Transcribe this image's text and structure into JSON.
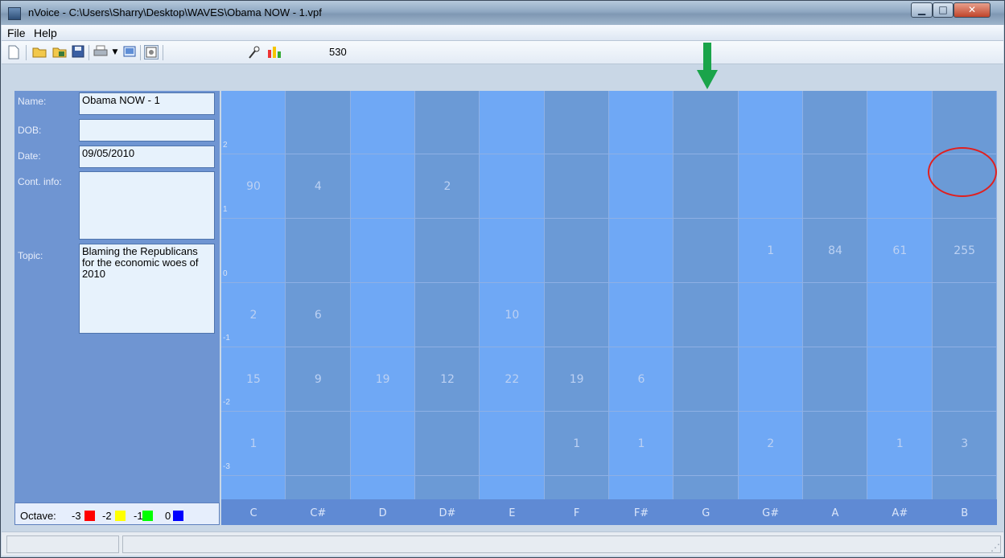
{
  "window": {
    "title": "nVoice - C:\\Users\\Sharry\\Desktop\\WAVES\\Obama NOW - 1.vpf",
    "min_glyph": "▁",
    "max_glyph": "□",
    "close_glyph": "✕"
  },
  "menu": {
    "file": "File",
    "help": "Help"
  },
  "toolbar": {
    "count": "530"
  },
  "form": {
    "name_label": "Name:",
    "name_value": "Obama NOW - 1",
    "dob_label": "DOB:",
    "dob_value": "",
    "date_label": "Date:",
    "date_value": "09/05/2010",
    "contact_label": "Cont. info:",
    "contact_value": "",
    "topic_label": "Topic:",
    "topic_value": "Blaming the Republicans for the economic woes of 2010"
  },
  "octave_legend": {
    "label": "Octave:",
    "items": [
      {
        "label": "-3",
        "color": "#ff0000"
      },
      {
        "label": "-2",
        "color": "#ffff00"
      },
      {
        "label": "-1",
        "color": "#00ff00"
      },
      {
        "label": "0",
        "color": "#0000ff"
      }
    ]
  },
  "grid": {
    "notes": [
      "C",
      "C#",
      "D",
      "D#",
      "E",
      "F",
      "F#",
      "G",
      "G#",
      "A",
      "A#",
      "B"
    ],
    "octave_ticks": [
      "2",
      "1",
      "0",
      "-1",
      "-2",
      "-3"
    ],
    "rows": [
      {
        "octave": "1",
        "values": [
          "90",
          "4",
          "",
          "2",
          "",
          "",
          "",
          "",
          "",
          "",
          "",
          ""
        ]
      },
      {
        "octave": "0",
        "values": [
          "",
          "",
          "",
          "",
          "",
          "",
          "",
          "",
          "1",
          "84",
          "61",
          "255"
        ]
      },
      {
        "octave": "-1",
        "values": [
          "2",
          "6",
          "",
          "",
          "10",
          "",
          "",
          "",
          "",
          "",
          "",
          ""
        ]
      },
      {
        "octave": "-2",
        "values": [
          "15",
          "9",
          "19",
          "12",
          "22",
          "19",
          "6",
          "",
          "",
          "",
          "",
          ""
        ]
      },
      {
        "octave": "-3",
        "values": [
          "1",
          "",
          "",
          "",
          "",
          "1",
          "1",
          "",
          "2",
          "",
          "1",
          "3"
        ]
      }
    ]
  },
  "colors": {
    "col_light": "#6fa8f5",
    "col_dark": "#6b9ad6",
    "arrow": "#1aa44a",
    "circle": "#e0201f"
  }
}
